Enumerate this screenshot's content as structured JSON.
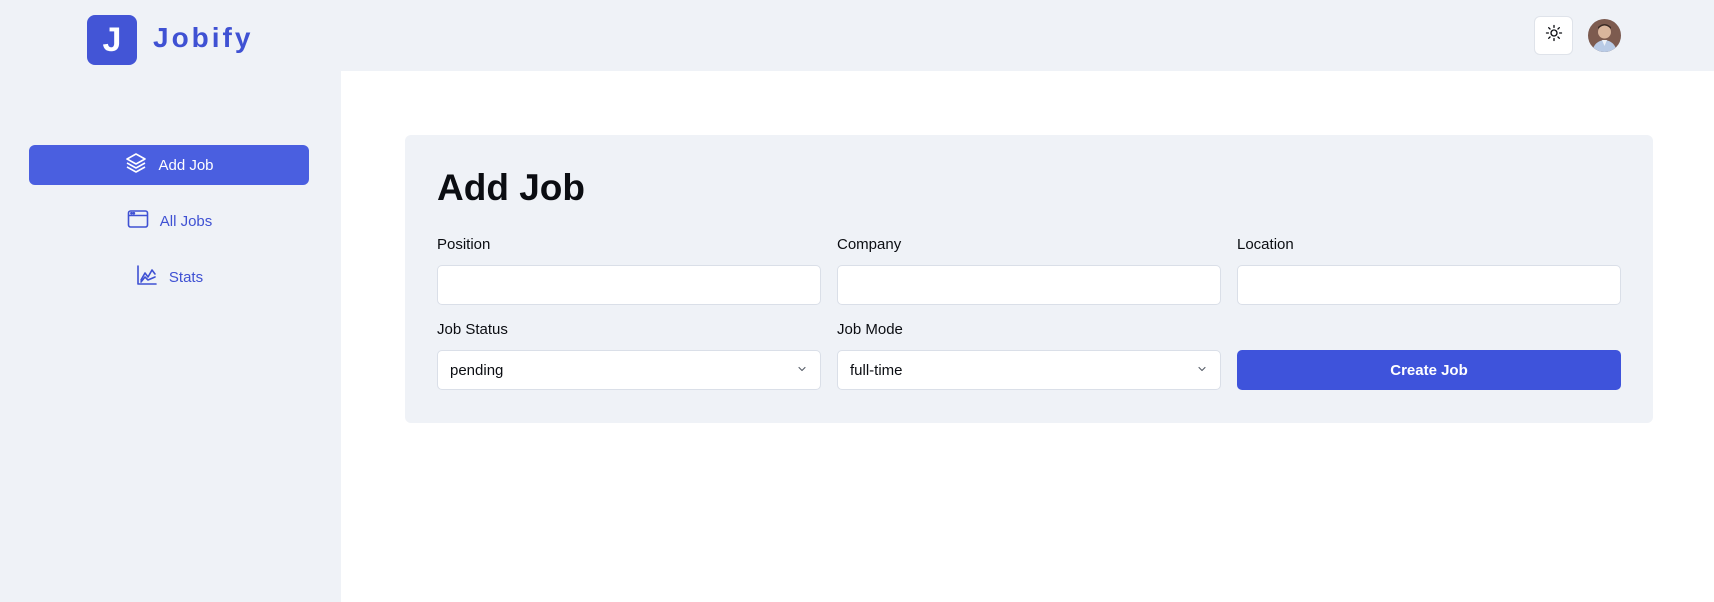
{
  "app": {
    "logo_letter": "J",
    "name": "Jobify",
    "accent": "#4355d6"
  },
  "sidebar": {
    "items": [
      {
        "label": "Add Job",
        "icon": "layers-icon",
        "active": true
      },
      {
        "label": "All Jobs",
        "icon": "browser-window-icon",
        "active": false
      },
      {
        "label": "Stats",
        "icon": "chart-icon",
        "active": false
      }
    ]
  },
  "header": {
    "theme_toggle_icon": "sun-icon",
    "avatar": "user-avatar"
  },
  "form": {
    "title": "Add Job",
    "position": {
      "label": "Position",
      "value": ""
    },
    "company": {
      "label": "Company",
      "value": ""
    },
    "location": {
      "label": "Location",
      "value": ""
    },
    "job_status": {
      "label": "Job Status",
      "value": "pending"
    },
    "job_mode": {
      "label": "Job Mode",
      "value": "full-time"
    },
    "submit_label": "Create Job"
  }
}
